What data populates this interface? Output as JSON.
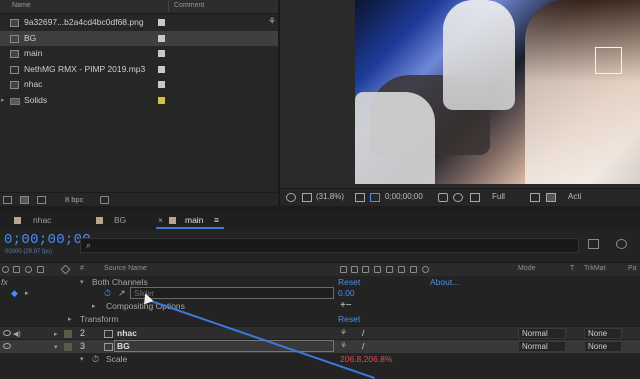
{
  "project": {
    "headers": {
      "name": "Name",
      "comment": "Comment"
    },
    "items": [
      {
        "name": "9a32697...b2a4cd4bc0df68.png",
        "type": "image",
        "swatch": "#c8c8c8",
        "selected": false,
        "twirl": ""
      },
      {
        "name": "BG",
        "type": "comp",
        "swatch": "#c8c8c8",
        "selected": true,
        "twirl": ""
      },
      {
        "name": "main",
        "type": "comp",
        "swatch": "#c8c8c8",
        "selected": false,
        "twirl": ""
      },
      {
        "name": "NethMG RMX - PIMP 2019.mp3",
        "type": "audio",
        "swatch": "#c8c8c8",
        "selected": false,
        "twirl": ""
      },
      {
        "name": "nhac",
        "type": "comp",
        "swatch": "#c8c8c8",
        "selected": false,
        "twirl": ""
      },
      {
        "name": "Solids",
        "type": "folder",
        "swatch": "#d8c040",
        "selected": false,
        "twirl": "▸"
      }
    ],
    "bpc": "8 bpc"
  },
  "viewer": {
    "zoom": "(31.8%)",
    "timecode": "0;00;00;00",
    "resolution": "Full",
    "active_label": "Acti"
  },
  "timeline": {
    "tabs": [
      {
        "label": "nhac",
        "swatch": "#b6a98a",
        "active": false
      },
      {
        "label": "BG",
        "swatch": "#b6a98a",
        "active": false
      },
      {
        "label": "main",
        "swatch": "#b6a98a",
        "active": true
      }
    ],
    "close_glyph": "×",
    "menu_glyph": "≡",
    "timecode": "0;00;00;00",
    "fps": "00000 (29.97 fps)",
    "search_glyph": "⌕",
    "columns": {
      "source_name": "Source Name",
      "hash": "#",
      "mode": "Mode",
      "t": "T",
      "trkmat": "TrkMat",
      "parent": "Pa"
    },
    "rows": {
      "fx": "fx",
      "both_channels": "Both Channels",
      "reset1": "Reset",
      "about": "About...",
      "slider_placeholder": "Slider",
      "slider_value": "0.00",
      "compositing": "Compositing Options",
      "plus_minus": "+−",
      "transform": "Transform",
      "reset2": "Reset",
      "scale": "Scale",
      "scale_value": "206.8,206.8%"
    },
    "layers": [
      {
        "index": "2",
        "name": "nhac",
        "mode": "Normal",
        "trkmat": "None",
        "swatch": "#5a5a4a",
        "selected": false
      },
      {
        "index": "3",
        "name": "BG",
        "mode": "Normal",
        "trkmat": "None",
        "swatch": "#5a5a4a",
        "selected": true
      }
    ]
  }
}
